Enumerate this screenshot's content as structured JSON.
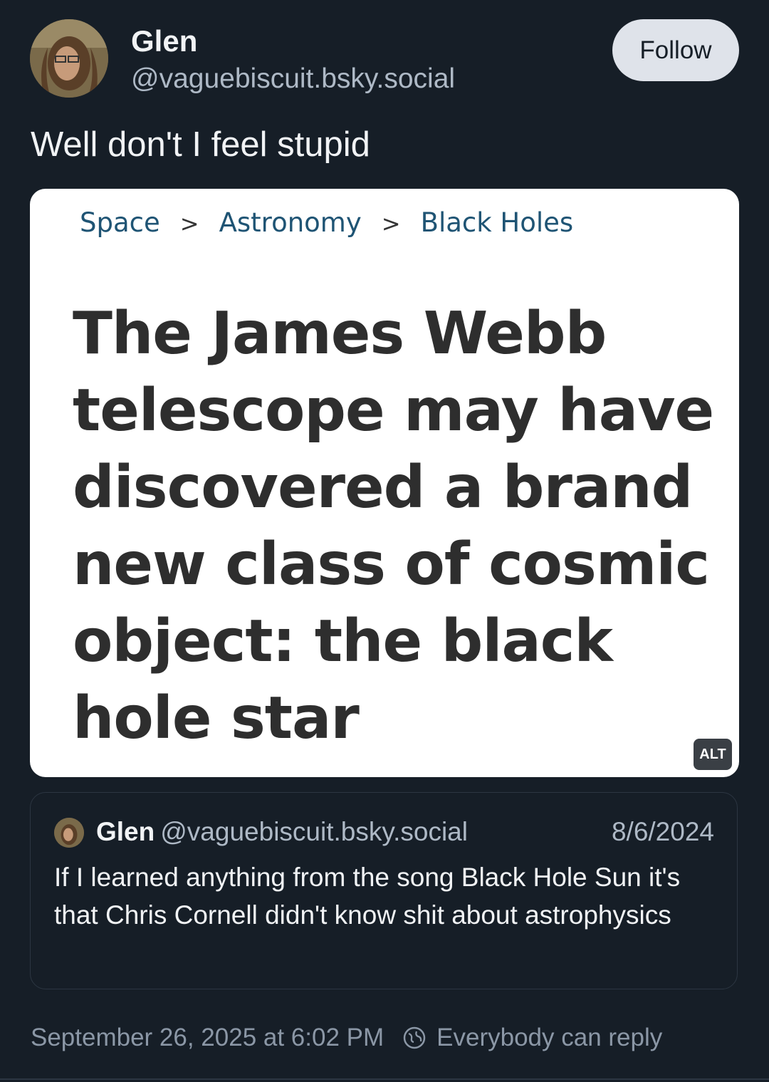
{
  "author": {
    "name": "Glen",
    "handle": "@vaguebiscuit.bsky.social"
  },
  "follow_label": "Follow",
  "post_text": "Well don't I feel stupid",
  "image": {
    "breadcrumbs": [
      "Space",
      "Astronomy",
      "Black Holes"
    ],
    "breadcrumb_separator": ">",
    "headline": "The James Webb telescope may have discovered a brand new class of cosmic object: the black hole star",
    "alt_badge": "ALT"
  },
  "quoted_post": {
    "name": "Glen",
    "handle": "@vaguebiscuit.bsky.social",
    "date": "8/6/2024",
    "text": "If I learned anything from the song Black Hole Sun it's that Chris Cornell didn't know shit about astrophysics"
  },
  "footer": {
    "timestamp": "September 26, 2025 at 6:02 PM",
    "reply_setting": "Everybody can reply",
    "reply_icon": "globe-reply-icon"
  },
  "colors": {
    "background": "#161e27",
    "handle_text": "#aeb9c6",
    "breadcrumb": "#1f5474",
    "follow_button": "#dfe3ea"
  }
}
